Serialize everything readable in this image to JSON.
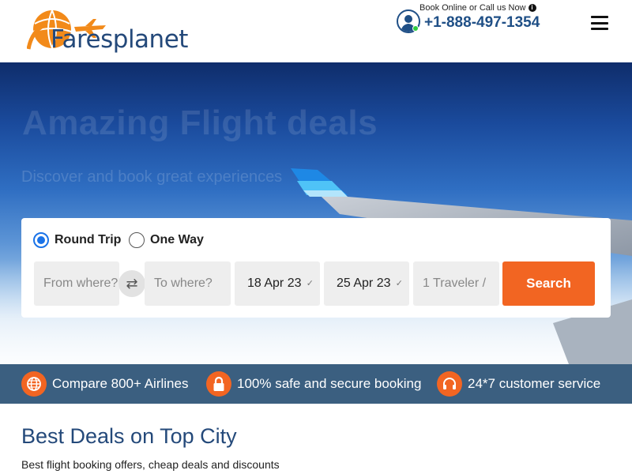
{
  "header": {
    "logo_text": "Faresplanet",
    "contact_prompt": "Book Online or Call us Now",
    "phone": "+1-888-497-1354",
    "icons": [
      "globe-plane-logo",
      "agent-icon",
      "info-icon",
      "hamburger-menu-icon"
    ]
  },
  "hero": {
    "title": "Amazing Flight deals",
    "subtitle": "Discover and book great experiences"
  },
  "search": {
    "trip_types": [
      {
        "label": "Round Trip",
        "selected": true
      },
      {
        "label": "One Way",
        "selected": false
      }
    ],
    "from_placeholder": "From where?",
    "to_placeholder": "To where?",
    "depart_date": "18 Apr 23",
    "return_date": "25 Apr 23",
    "travelers": "1 Traveler / ",
    "search_label": "Search",
    "swap_icon": "swap-arrows-icon"
  },
  "features": [
    {
      "icon": "globe-icon",
      "text": "Compare 800+ Airlines"
    },
    {
      "icon": "lock-icon",
      "text": "100% safe and secure booking"
    },
    {
      "icon": "headset-icon",
      "text": "24*7 customer service"
    }
  ],
  "deals": {
    "title": "Best Deals on Top City",
    "subtitle": "Best flight booking offers, cheap deals and discounts"
  },
  "colors": {
    "brand_blue": "#24497a",
    "accent_orange": "#f26522",
    "feature_bar": "#3b5f80",
    "radio_blue": "#1a73e8"
  }
}
